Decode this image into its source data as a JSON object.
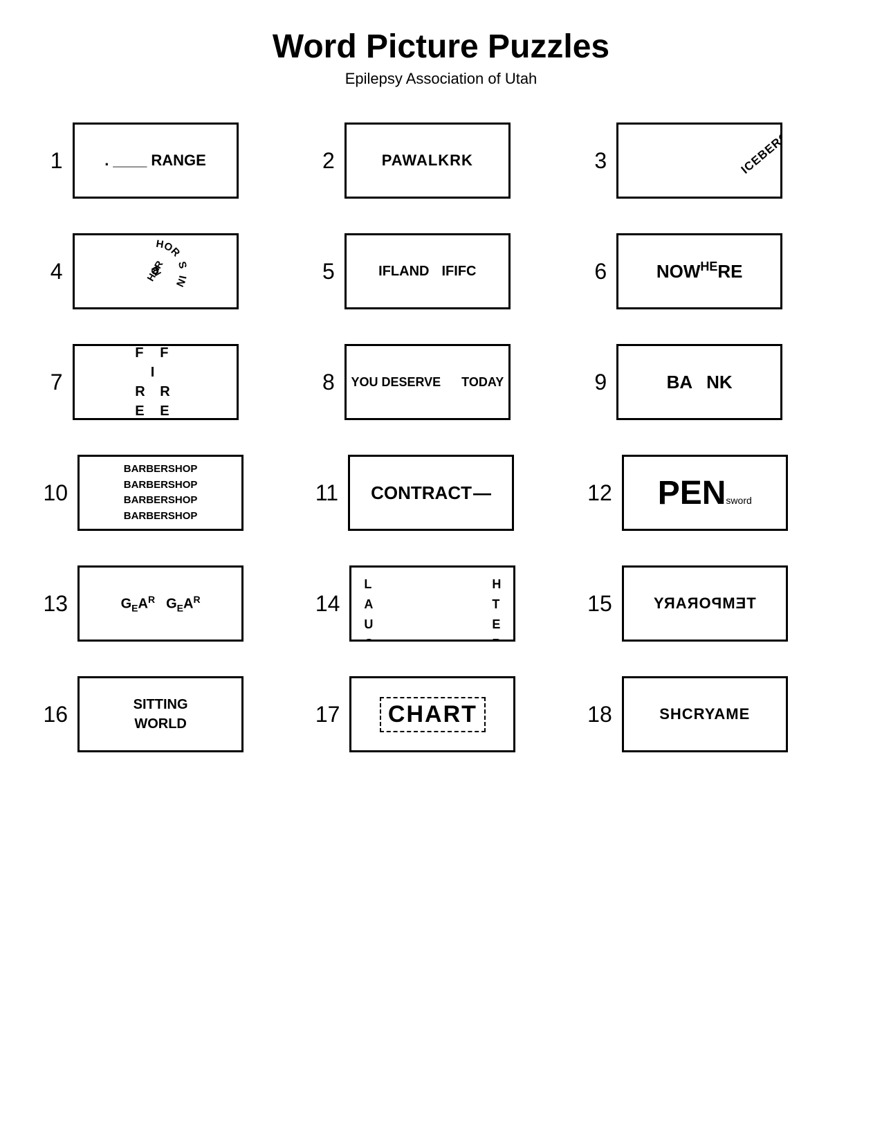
{
  "page": {
    "title": "Word Picture Puzzles",
    "subtitle": "Epilepsy Association of Utah"
  },
  "puzzles": [
    {
      "number": "1",
      "label": "dot-blank-range"
    },
    {
      "number": "2",
      "label": "pawalkrk"
    },
    {
      "number": "3",
      "label": "iceberg"
    },
    {
      "number": "4",
      "label": "horsing-around"
    },
    {
      "number": "5",
      "label": "if-land-if-ifc"
    },
    {
      "number": "6",
      "label": "nowhere"
    },
    {
      "number": "7",
      "label": "fire"
    },
    {
      "number": "8",
      "label": "you-deserve-today"
    },
    {
      "number": "9",
      "label": "bank"
    },
    {
      "number": "10",
      "label": "barbershop"
    },
    {
      "number": "11",
      "label": "contract"
    },
    {
      "number": "12",
      "label": "pensword"
    },
    {
      "number": "13",
      "label": "gear-gear"
    },
    {
      "number": "14",
      "label": "laughter"
    },
    {
      "number": "15",
      "label": "temporary"
    },
    {
      "number": "16",
      "label": "sitting-world"
    },
    {
      "number": "17",
      "label": "chart"
    },
    {
      "number": "18",
      "label": "shcryame"
    }
  ]
}
